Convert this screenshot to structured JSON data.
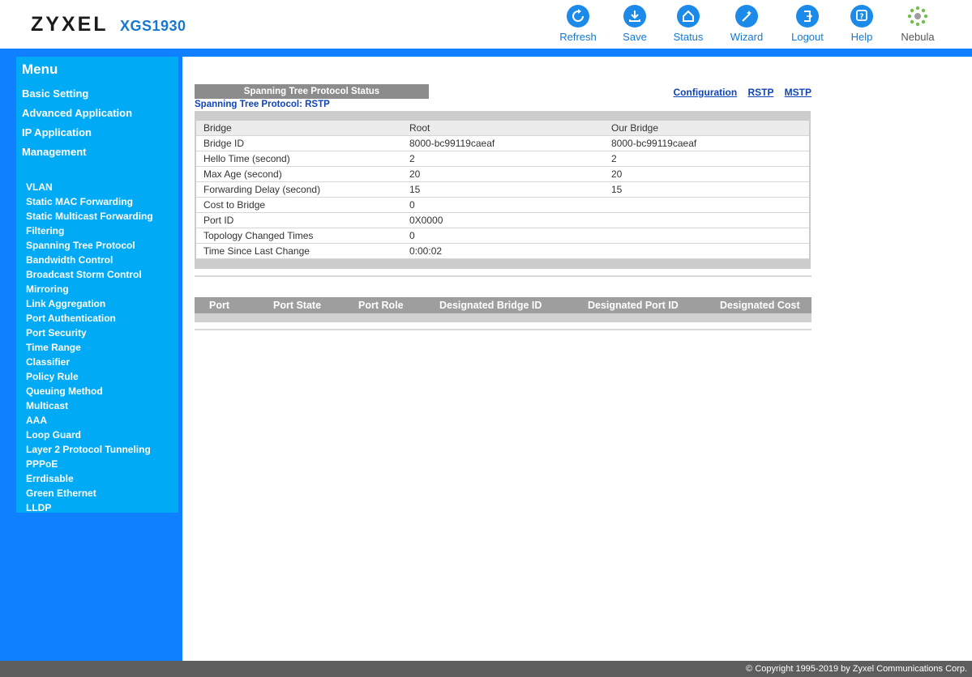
{
  "header": {
    "brand": "ZYXEL",
    "model": "XGS1930",
    "toolbar": [
      {
        "id": "refresh",
        "label": "Refresh",
        "icon": "refresh-icon"
      },
      {
        "id": "save",
        "label": "Save",
        "icon": "download-icon"
      },
      {
        "id": "status",
        "label": "Status",
        "icon": "home-icon"
      },
      {
        "id": "wizard",
        "label": "Wizard",
        "icon": "magic-wand-icon"
      },
      {
        "id": "logout",
        "label": "Logout",
        "icon": "logout-icon"
      },
      {
        "id": "help",
        "label": "Help",
        "icon": "help-icon"
      },
      {
        "id": "nebula",
        "label": "Nebula",
        "icon": "nebula-icon"
      }
    ]
  },
  "menu": {
    "title": "Menu",
    "main_items": [
      "Basic Setting",
      "Advanced Application",
      "IP Application",
      "Management"
    ],
    "sub_items": [
      "VLAN",
      "Static MAC Forwarding",
      "Static Multicast Forwarding",
      "Filtering",
      "Spanning Tree Protocol",
      "Bandwidth Control",
      "Broadcast Storm Control",
      "Mirroring",
      "Link Aggregation",
      "Port Authentication",
      "Port Security",
      "Time Range",
      "Classifier",
      "Policy Rule",
      "Queuing Method",
      "Multicast",
      "AAA",
      "Loop Guard",
      "Layer 2 Protocol Tunneling",
      "PPPoE",
      "Errdisable",
      "Green Ethernet",
      "LLDP"
    ]
  },
  "content": {
    "panel_title": "Spanning Tree Protocol Status",
    "protocol_label": "Spanning Tree Protocol: RSTP",
    "links": [
      "Configuration",
      "RSTP",
      "MSTP"
    ],
    "status_table": {
      "header": [
        "Bridge",
        "Root",
        "Our Bridge"
      ],
      "rows": [
        [
          "Bridge ID",
          "8000-bc99119caeaf",
          "8000-bc99119caeaf"
        ],
        [
          "Hello Time (second)",
          "2",
          "2"
        ],
        [
          "Max Age (second)",
          "20",
          "20"
        ],
        [
          "Forwarding Delay (second)",
          "15",
          "15"
        ],
        [
          "Cost to Bridge",
          "0",
          ""
        ],
        [
          "Port ID",
          "0X0000",
          ""
        ],
        [
          "Topology Changed Times",
          "0",
          ""
        ],
        [
          "Time Since Last Change",
          "0:00:02",
          ""
        ]
      ]
    },
    "port_table_headers": [
      "Port",
      "Port State",
      "Port Role",
      "Designated Bridge ID",
      "Designated Port ID",
      "Designated Cost"
    ]
  },
  "footer": {
    "copyright": "© Copyright 1995-2019 by Zyxel Communications Corp."
  },
  "colors": {
    "accent_blue": "#0f80ff",
    "menu_light_blue": "#00aaf5",
    "link_blue": "#1144b8",
    "header_gray": "#8c8c8c"
  }
}
